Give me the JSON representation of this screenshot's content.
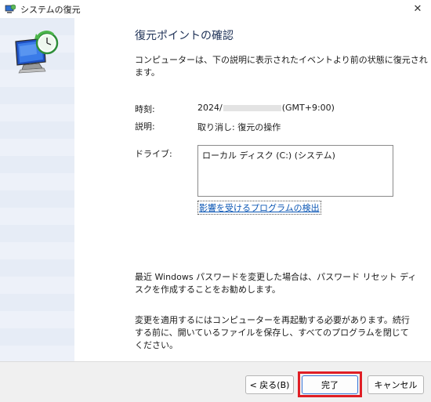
{
  "window": {
    "title": "システムの復元",
    "close_glyph": "✕"
  },
  "page": {
    "title": "復元ポイントの確認",
    "description": "コンピューターは、下の説明に表示されたイベントより前の状態に復元されます。"
  },
  "details": {
    "time_label": "時刻:",
    "time_value_prefix": "2024/",
    "time_value_suffix": "(GMT+9:00)",
    "description_label": "説明:",
    "description_value": "取り消し: 復元の操作",
    "drives_label": "ドライブ:",
    "drives": [
      "ローカル ディスク (C:) (システム)"
    ],
    "affected_programs_link": "影響を受けるプログラムの検出"
  },
  "notes": {
    "password_note": "最近 Windows パスワードを変更した場合は、パスワード リセット ディスクを作成することをお勧めします。",
    "restart_note": "変更を適用するにはコンピューターを再起動する必要があります。続行する前に、開いているファイルを保存し、すべてのプログラムを閉じてください。"
  },
  "buttons": {
    "back": "< 戻る(B)",
    "finish": "完了",
    "cancel": "キャンセル"
  },
  "icons": {
    "title_icon": "system-restore-icon",
    "big_icon": "system-restore-monitor-clock-icon"
  },
  "colors": {
    "highlight_border": "#e01e25",
    "link": "#0b56b4",
    "title_text": "#1c2f55"
  }
}
